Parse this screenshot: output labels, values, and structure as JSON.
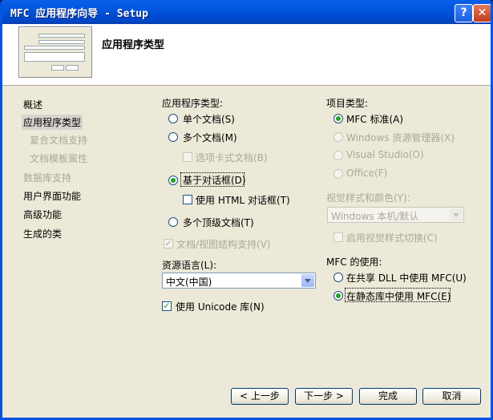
{
  "window": {
    "title": "MFC 应用程序向导 - Setup",
    "help_button": "?",
    "close_button": "✕"
  },
  "header": {
    "title": "应用程序类型"
  },
  "nav": {
    "items": [
      {
        "label": "概述",
        "state": "normal"
      },
      {
        "label": "应用程序类型",
        "state": "selected"
      },
      {
        "label": "复合文档支持",
        "state": "disabled"
      },
      {
        "label": "文档模板属性",
        "state": "disabled"
      },
      {
        "label": "数据库支持",
        "state": "disabled"
      },
      {
        "label": "用户界面功能",
        "state": "normal"
      },
      {
        "label": "高级功能",
        "state": "normal"
      },
      {
        "label": "生成的类",
        "state": "normal"
      }
    ]
  },
  "app_type": {
    "heading": "应用程序类型:",
    "single_doc": "单个文档(S)",
    "multi_doc": "多个文档(M)",
    "tabbed_docs": "选项卡式文档(B)",
    "dialog_based": "基于对话框(D)",
    "use_html_dialog": "使用 HTML 对话框(T)",
    "multi_toplevel": "多个顶级文档(T)",
    "doc_view_support": "文档/视图结构支持(V)",
    "selected": "dialog_based"
  },
  "resource_lang": {
    "heading": "资源语言(L):",
    "value": "中文(中国)"
  },
  "unicode": {
    "label": "使用 Unicode 库(N)",
    "checked": true
  },
  "project_type": {
    "heading": "项目类型:",
    "mfc_standard": "MFC 标准(A)",
    "windows_explorer": "Windows 资源管理器(X)",
    "visual_studio": "Visual Studio(O)",
    "office": "Office(F)",
    "selected": "mfc_standard"
  },
  "visual_style": {
    "heading": "视觉样式和颜色(Y):",
    "value": "Windows 本机/默认",
    "toggle_label": "启用视觉样式切换(C)"
  },
  "mfc_usage": {
    "heading": "MFC 的使用:",
    "shared_dll": "在共享 DLL 中使用 MFC(U)",
    "static_lib": "在静态库中使用 MFC(E)",
    "selected": "static_lib"
  },
  "buttons": {
    "prev": "< 上一步",
    "next": "下一步 >",
    "finish": "完成",
    "cancel": "取消"
  },
  "colors": {
    "title_bar": "#0055e5",
    "dialog_bg": "#ece9d8",
    "radio_dot": "#21a121"
  }
}
